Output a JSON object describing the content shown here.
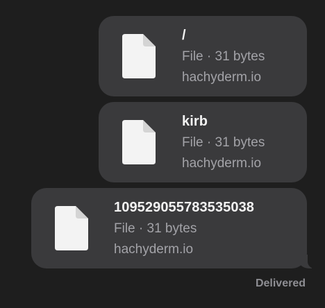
{
  "messages": [
    {
      "title": "/",
      "meta": "File · 31 bytes",
      "domain": "hachyderm.io",
      "icon": "document-icon"
    },
    {
      "title": "kirb",
      "meta": "File · 31 bytes",
      "domain": "hachyderm.io",
      "icon": "document-icon"
    },
    {
      "title": "109529055783535038",
      "meta": "File · 31 bytes",
      "domain": "hachyderm.io",
      "icon": "document-icon"
    }
  ],
  "status": "Delivered",
  "colors": {
    "background": "#1e1e1e",
    "bubble": "#3a3a3c",
    "title": "#f2f2f2",
    "secondary": "#a3a3a8"
  }
}
